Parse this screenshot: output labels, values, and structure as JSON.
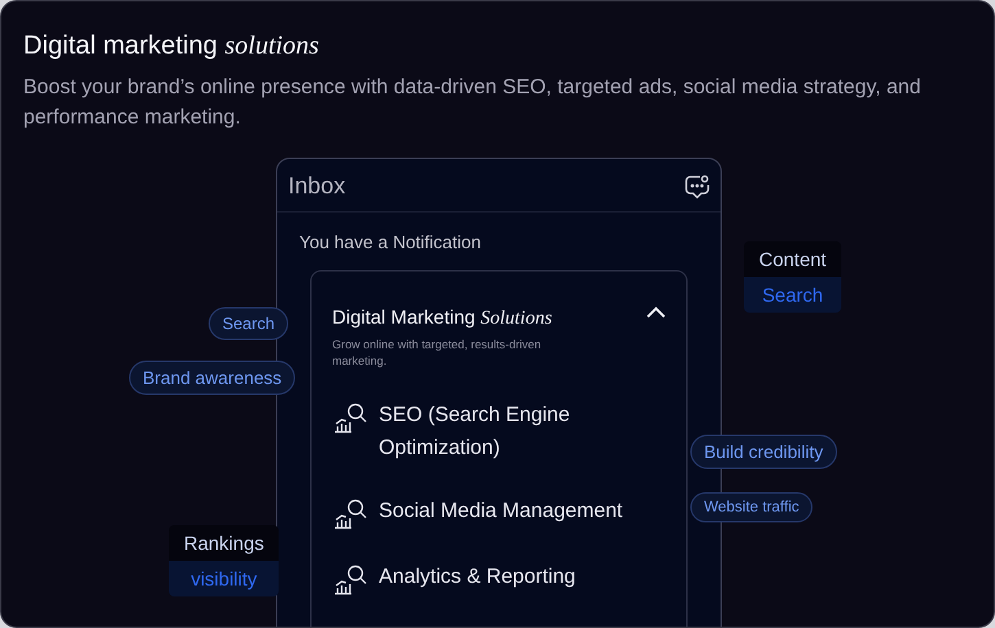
{
  "header": {
    "title": "Digital marketing *solutions*",
    "description": "Boost your brand’s online presence with data-driven SEO, targeted ads, social media strategy, and performance marketing."
  },
  "inbox": {
    "title": "Inbox",
    "notice": "You have a Notification",
    "card": {
      "title": "Digital Marketing *Solutions*",
      "subtitle": "Grow online with targeted, results-driven marketing.",
      "expanded": true,
      "items": [
        "SEO (Search Engine Optimization)",
        "Social Media Management",
        "Analytics & Reporting"
      ]
    }
  },
  "tags": [
    {
      "kind": "stack",
      "top": "Content",
      "bottom": "Search"
    },
    {
      "label": "Search",
      "kind": "pill"
    },
    {
      "label": "Brand awareness",
      "kind": "pill"
    },
    {
      "label": "Build credibility",
      "kind": "pill"
    },
    {
      "label": "Website traffic",
      "kind": "pill"
    },
    {
      "kind": "stack",
      "top": "Rankings",
      "bottom": "visibility"
    }
  ]
}
